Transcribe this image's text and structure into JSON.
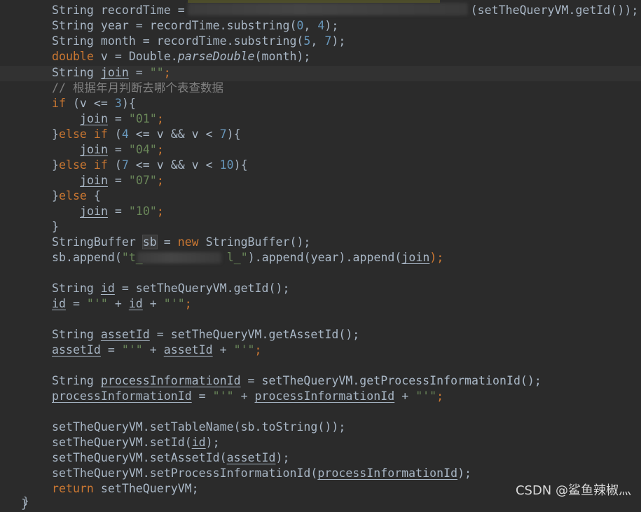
{
  "code": {
    "l1": [
      "String recordTime = ",
      "(setTheQueryVM.getId());"
    ],
    "l2": [
      "String year = recordTime.substring(",
      "0",
      ", ",
      "4",
      ");"
    ],
    "l3": [
      "String month = recordTime.substring(",
      "5",
      ", ",
      "7",
      ");"
    ],
    "l4": [
      "double",
      " v = Double.",
      "parseDouble",
      "(month);"
    ],
    "l5": [
      "String ",
      "join",
      " = ",
      "\"\"",
      ";"
    ],
    "l6": "// 根据年月判断去哪个表查数据",
    "l7": [
      "if",
      " (v <= ",
      "3",
      "){"
    ],
    "l8": [
      "join",
      " = ",
      "\"01\"",
      ";"
    ],
    "l9": [
      "}",
      "else if",
      " (",
      "4",
      " <= v && v < ",
      "7",
      "){"
    ],
    "l10": [
      "join",
      " = ",
      "\"04\"",
      ";"
    ],
    "l11": [
      "}",
      "else if",
      " (",
      "7",
      " <= v && v < ",
      "10",
      "){"
    ],
    "l12": [
      "join",
      " = ",
      "\"07\"",
      ";"
    ],
    "l13": [
      "}",
      "else",
      " {"
    ],
    "l14": [
      "join",
      " = ",
      "\"10\"",
      ";"
    ],
    "l15": "}",
    "l16": [
      "StringBuffer ",
      "sb",
      " = ",
      "new",
      " StringBuffer();"
    ],
    "l17": [
      "sb.append(",
      "\"t_",
      "l_\"",
      ").append(year).append(",
      "join",
      ");"
    ],
    "l18": [
      "String ",
      "id",
      " = setTheQueryVM.getId();"
    ],
    "l19": [
      "id",
      " = ",
      "\"'\"",
      " + ",
      "id",
      " + ",
      "\"'\"",
      ";"
    ],
    "l20": [
      "String ",
      "assetId",
      " = setTheQueryVM.getAssetId();"
    ],
    "l21": [
      "assetId",
      " = ",
      "\"'\"",
      " + ",
      "assetId",
      " + ",
      "\"'\"",
      ";"
    ],
    "l22": [
      "String ",
      "processInformationId",
      " = setTheQueryVM.getProcessInformationId();"
    ],
    "l23": [
      "processInformationId",
      " = ",
      "\"'\"",
      " + ",
      "processInformationId",
      " + ",
      "\"'\"",
      ";"
    ],
    "l24": "setTheQueryVM.setTableName(sb.toString());",
    "l25": [
      "setTheQueryVM.setId(",
      "id",
      ");"
    ],
    "l26": [
      "setTheQueryVM.setAssetId(",
      "assetId",
      ");"
    ],
    "l27": [
      "setTheQueryVM.setProcessInformationId(",
      "processInformationId",
      ");"
    ],
    "l28": [
      "return",
      " setTheQueryVM;"
    ],
    "l29": "}"
  },
  "watermark": "CSDN @鲨鱼辣椒灬",
  "colors": {
    "background": "#2b2b2b",
    "text": "#a9b7c6",
    "keyword": "#cc7832",
    "string": "#6a8759",
    "number": "#6897bb",
    "comment": "#808080",
    "current_line": "#323232"
  }
}
